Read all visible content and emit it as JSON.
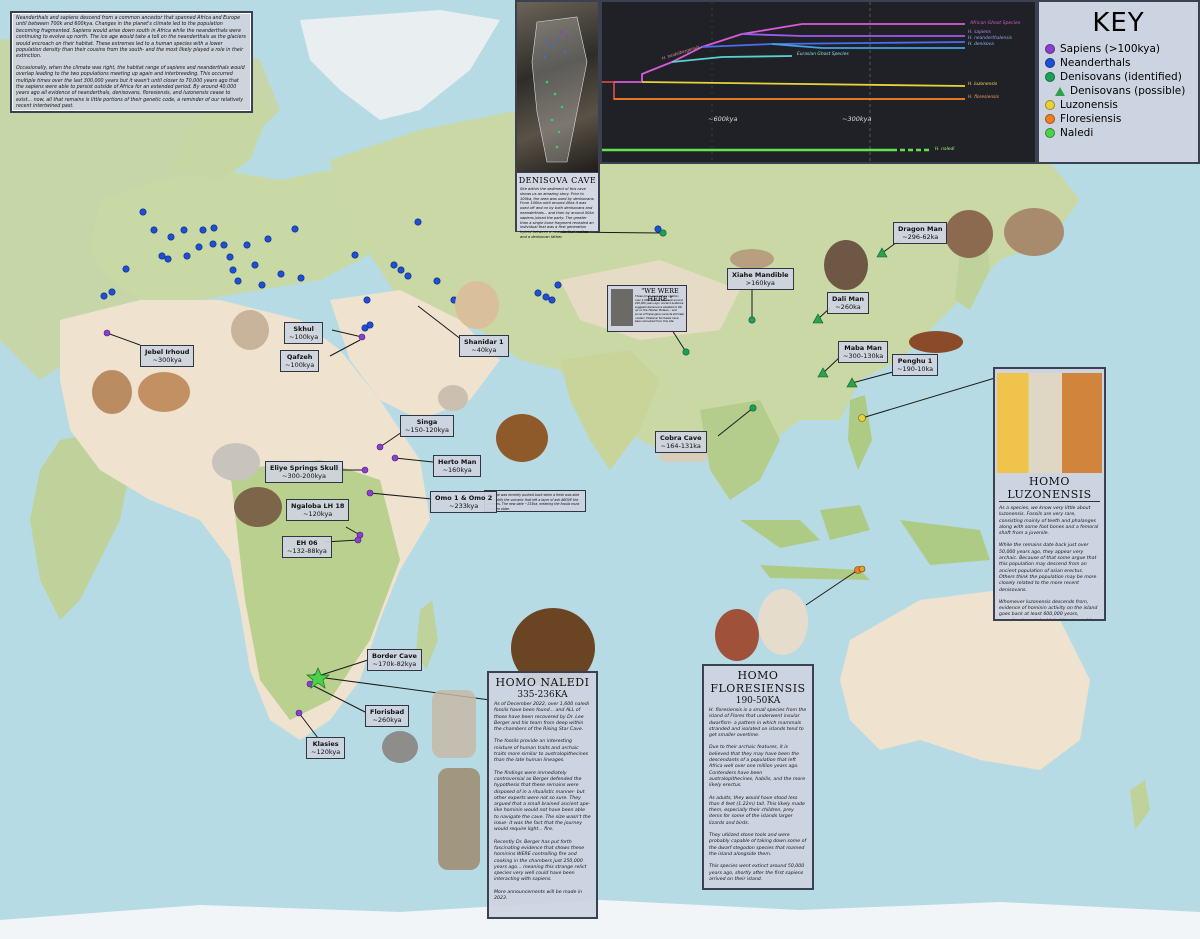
{
  "intro": {
    "p1": "Neanderthals and sapiens descend from a common ancestor that spanned Africa and Europe until between 700k and 600kya. Changes in the planet's climate led to the population becoming fragmented. Sapiens would arise down south in Africa while the neanderthals were continuing to evolve up north. The ice age would take a toll on the neanderthals as the glaciers would encroach on their habitat. These extremes led to a human species with a lower population density than their cousins from the south- and the most likely played a role in their extinction.",
    "p2": "Occasionally, when the climate was right, the habitat range of sapiens and neanderthals would overlap leading to the two populations meeting up again and interbreeding. This occurred multiple times over the last 300,000 years but it wasn't until closer to 70,000 years ago that the sapiens were able to persist outside of Africa for an extended period. By around 40,000 years ago all evidence of neanderthals, denisovans, floresiensis, and luzonensis cease to exist... now, all that remains is little portions of their genetic code, a reminder of our relatively recent intertwined past."
  },
  "key": {
    "title": "KEY",
    "items": [
      {
        "label": "Sapiens (>100kya)",
        "color": "#8a3fd1",
        "shape": "dot"
      },
      {
        "label": "Neanderthals",
        "color": "#1f4fd6",
        "shape": "dot"
      },
      {
        "label": "Denisovans (identified)",
        "color": "#1fa05a",
        "shape": "dot"
      },
      {
        "label": "Denisovans (possible)",
        "color": "#2fa04c",
        "shape": "triangle"
      },
      {
        "label": "Luzonensis",
        "color": "#e8d23a",
        "shape": "dot"
      },
      {
        "label": "Floresiensis",
        "color": "#ef7f22",
        "shape": "dot"
      },
      {
        "label": "Naledi",
        "color": "#4bd14b",
        "shape": "dot"
      }
    ]
  },
  "timeline": {
    "species": [
      {
        "label": "African Ghost Species",
        "color": "#d75bd6"
      },
      {
        "label": "H. sapiens",
        "color": "#9b5cf0"
      },
      {
        "label": "H. neanderthalensis",
        "color": "#4a6ef2"
      },
      {
        "label": "H. denisova",
        "color": "#3fa3e6"
      },
      {
        "label": "Eurasian Ghost Species",
        "color": "#5ad0d0"
      },
      {
        "label": "H. heidelbergensis",
        "color": "#c94a4a"
      },
      {
        "label": "H. luzonensis",
        "color": "#e8d23a"
      },
      {
        "label": "H. floresiensis",
        "color": "#ef7f22"
      },
      {
        "label": "H. naledi",
        "color": "#62e34a"
      }
    ],
    "ticks": [
      "~600kya",
      "~300kya"
    ]
  },
  "cave": {
    "title": "DENISOVA CAVE",
    "text": "Site within the sediment of this cave shows us an amazing story. Prior to 100ka, the area was used by denisovans. From 100ka until around 40ka it was used off and on by both denisovans and neanderthals... and then by around 50ka sapiens joined the party. The greater than a single bone fragment revealed an individual that was a first generation hybrid between a neanderthal mother and a denisovan father."
  },
  "here": {
    "title": "\"WE WERE HERE.\"",
    "text": "These prints were left by children over 4,000m above sea level around 226,000 years ago. Ancient evidence suggests denisovans adapted to life up on the Tibetan Plateau... and some of these gene variants still help modern Tibetans! No fossils have been recovered from this site."
  },
  "omo_note": "The age was recently pushed back when a fresh was able to identify the volcanic that left a layer of ash ABOVE the remains. The new date ~233ka, meaning the fossils must be even older.",
  "labels": {
    "jebel": {
      "name": "Jebel Irhoud",
      "age": "~300kya"
    },
    "skhul": {
      "name": "Skhul",
      "age": "~100kya"
    },
    "qafzeh": {
      "name": "Qafzeh",
      "age": "~100kya"
    },
    "shanidar": {
      "name": "Shanidar 1",
      "age": "~40kya"
    },
    "singa": {
      "name": "Singa",
      "age": "~150-120kya"
    },
    "herto": {
      "name": "Herto Man",
      "age": "~160kya"
    },
    "eliye": {
      "name": "Eliye Springs Skull",
      "age": "~300-200kya"
    },
    "omo": {
      "name": "Omo 1 & Omo 2",
      "age": "~233kya"
    },
    "ngaloba": {
      "name": "Ngaloba LH 18",
      "age": "~120kya"
    },
    "eh06": {
      "name": "EH 06",
      "age": "~132-88kya"
    },
    "border": {
      "name": "Border Cave",
      "age": "~170k-82kya"
    },
    "florisbad": {
      "name": "Florisbad",
      "age": "~260kya"
    },
    "klasies": {
      "name": "Klasies",
      "age": "~120kya"
    },
    "xiahe": {
      "name": "Xiahe Mandible",
      "age": ">160kya"
    },
    "dragon": {
      "name": "Dragon Man",
      "age": "~296-62ka"
    },
    "dali": {
      "name": "Dali Man",
      "age": "~260ka"
    },
    "maba": {
      "name": "Maba Man",
      "age": "~300-130ka"
    },
    "penghu": {
      "name": "Penghu 1",
      "age": "~190-10ka"
    },
    "cobra": {
      "name": "Cobra Cave",
      "age": "~164-131ka"
    }
  },
  "luzonensis": {
    "title": "HOMO LUZONENSIS",
    "p1": "As a species, we know very little about luzonensis. Fossils are very rare, consisting mainly of teeth and phalanges along with some foot bones and a femoral shaft from a juvenile.",
    "p2": "While the remains date back just over 50,000 years ago, they appear very archaic. Because of that some argue that this population may descend from an ancient population of asian erectus. Others think the population may be more closely related to the more recent denisovans.",
    "p3": "Whomever luzonensis descends from, evidence of hominin activity on the island goes back at least 600,000 years, meaning the original inhabitants would have had to have crossed a large portion of water before arriving on the island of Luzon."
  },
  "naledi": {
    "title": "HOMO NALEDI",
    "date": "335-236KA",
    "p1": "As of December 2022, over 1,600 naledi fossils have been found... and ALL of those have been recovered by Dr. Lee Berger and his team from deep within the chambers of the Rising Star Cave.",
    "p2": "The fossils provide an interesting mixture of human traits and archaic traits more similar to australopithecines than the late human lineages.",
    "p3": "The findings were immediately controversial as Berger defended the hypothesis that these remains were disposed of in a ritualistic manner- but other experts were not so sure. They argued that a small brained ancient ape-like hominin would not have been able to navigate the cave. The size wasn't the issue- it was the fact that the journey would require light... fire.",
    "p4": "Recently Dr. Berger has put forth fascinating evidence that shows these hominins WERE controlling fire and cooking in the chambers just 250,000 years ago... meaning this strange relict species very well could have been interacting with sapiens.",
    "p5": "More announcements will be made in 2023."
  },
  "floresiensis": {
    "title": "HOMO FLORESIENSIS",
    "date": "190-50KA",
    "p1": "H. floresiensis is a small species from the island of Flores that underwent insular dwarfism- a pattern in which mammals stranded and isolated on islands tend to get smaller overtime.",
    "p2": "Due to their archaic features, it is believed that they may have been the descendants of a population that left Africa well over one million years ago. Contenders have been australopithecines, habilis, and the more likely erectus.",
    "p3": "As adults, they would have stood less than 4 feet (1.22m) tall. This likely made them, especially their children, prey items for some of the islands larger lizards and birds.",
    "p4": "They utilized stone tools and were probably capable of taking down some of the dwarf stegodon species that roamed the island alongside them.",
    "p5": "This species went extinct around 50,000 years ago, shortly after the first sapiens arrived on their island."
  }
}
